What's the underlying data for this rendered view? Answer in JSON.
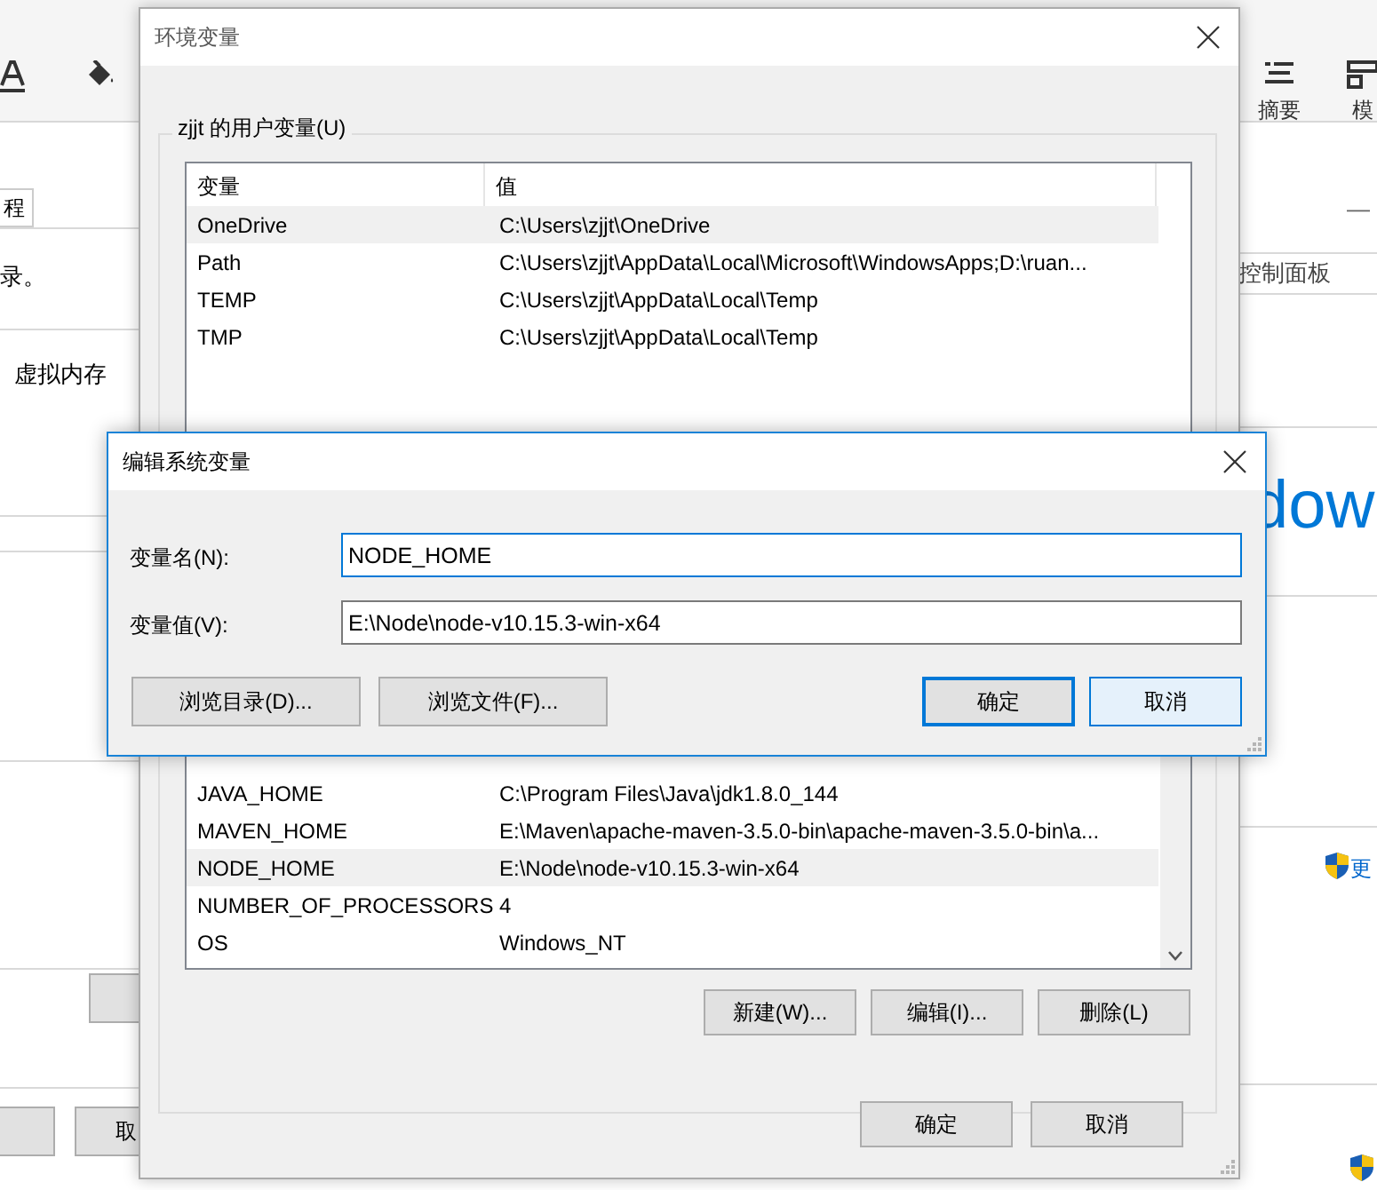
{
  "background": {
    "left_tab": "程",
    "left_texts": [
      "录。",
      "虚拟内存"
    ],
    "left_cancel": "取",
    "right_toolbar": [
      {
        "label": "摘要",
        "kind": "summary"
      },
      {
        "label": "模",
        "kind": "template"
      }
    ],
    "right_link": "控制面板",
    "right_heading": "dow",
    "right_shield_text": "更",
    "minimize": "—"
  },
  "env_dialog": {
    "title": "环境变量",
    "user_group": "zjjt 的用户变量(U)",
    "columns": [
      "变量",
      "值"
    ],
    "user_rows": [
      {
        "name": "OneDrive",
        "value": "C:\\Users\\zjjt\\OneDrive",
        "selected": true
      },
      {
        "name": "Path",
        "value": "C:\\Users\\zjjt\\AppData\\Local\\Microsoft\\WindowsApps;D:\\ruan...",
        "selected": false
      },
      {
        "name": "TEMP",
        "value": "C:\\Users\\zjjt\\AppData\\Local\\Temp",
        "selected": false
      },
      {
        "name": "TMP",
        "value": "C:\\Users\\zjjt\\AppData\\Local\\Temp",
        "selected": false
      }
    ],
    "system_rows": [
      {
        "name": "JAVA_HOME",
        "value": "C:\\Program Files\\Java\\jdk1.8.0_144",
        "selected": false
      },
      {
        "name": "MAVEN_HOME",
        "value": "E:\\Maven\\apache-maven-3.5.0-bin\\apache-maven-3.5.0-bin\\a...",
        "selected": false
      },
      {
        "name": "NODE_HOME",
        "value": "E:\\Node\\node-v10.15.3-win-x64",
        "selected": true
      },
      {
        "name": "NUMBER_OF_PROCESSORS",
        "value": "4",
        "selected": false
      },
      {
        "name": "OS",
        "value": "Windows_NT",
        "selected": false
      }
    ],
    "system_buttons": [
      "新建(W)...",
      "编辑(I)...",
      "删除(L)"
    ],
    "buttons": [
      "确定",
      "取消"
    ]
  },
  "edit_dialog": {
    "title": "编辑系统变量",
    "fields": [
      {
        "label": "变量名(N):",
        "value": "NODE_HOME",
        "focused": true
      },
      {
        "label": "变量值(V):",
        "value": "E:\\Node\\node-v10.15.3-win-x64",
        "focused": false
      }
    ],
    "browse_buttons": [
      "浏览目录(D)...",
      "浏览文件(F)..."
    ],
    "buttons": [
      {
        "label": "确定",
        "default": true
      },
      {
        "label": "取消",
        "default": false
      }
    ]
  }
}
